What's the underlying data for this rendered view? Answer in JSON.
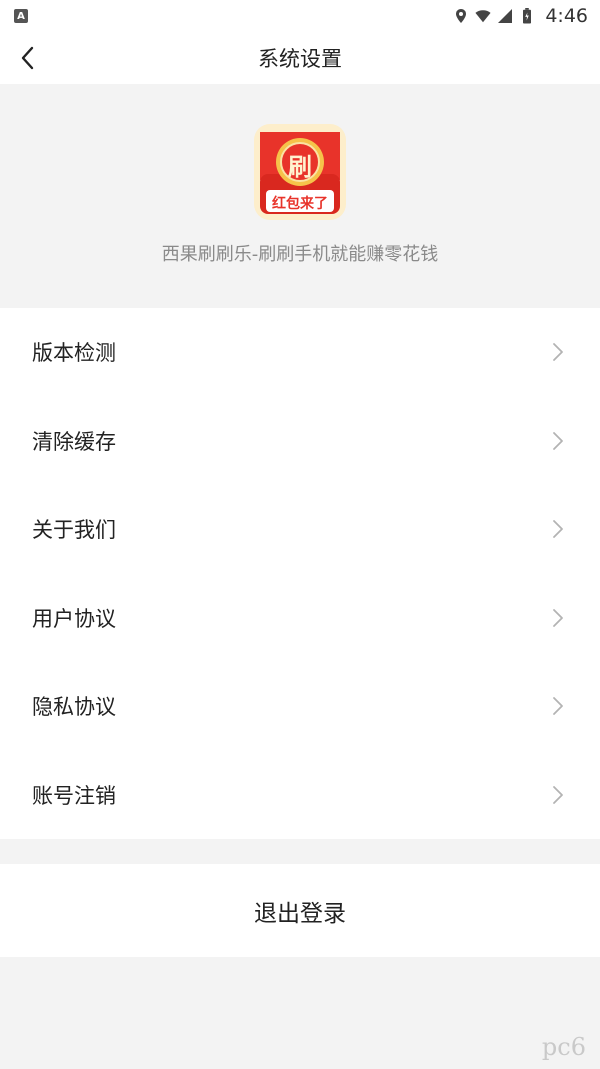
{
  "status_bar": {
    "notification_letter": "A",
    "time": "4:46",
    "icons": [
      "location-icon",
      "wifi-icon",
      "signal-icon",
      "battery-icon"
    ]
  },
  "header": {
    "title": "系统设置",
    "back_icon": "chevron-left-icon"
  },
  "app_info": {
    "logo_char": "刷",
    "logo_banner": "红包来了",
    "name": "西果刷刷乐-刷刷手机就能赚零花钱"
  },
  "menu": {
    "items": [
      {
        "label": "版本检测"
      },
      {
        "label": "清除缓存"
      },
      {
        "label": "关于我们"
      },
      {
        "label": "用户协议"
      },
      {
        "label": "隐私协议"
      },
      {
        "label": "账号注销"
      }
    ],
    "arrow_icon": "chevron-right-icon"
  },
  "logout": {
    "label": "退出登录"
  },
  "watermark": {
    "text": "pc6"
  },
  "colors": {
    "background": "#f3f3f3",
    "surface": "#ffffff",
    "logo_red": "#e8332a",
    "logo_gold": "#f6c24a"
  }
}
